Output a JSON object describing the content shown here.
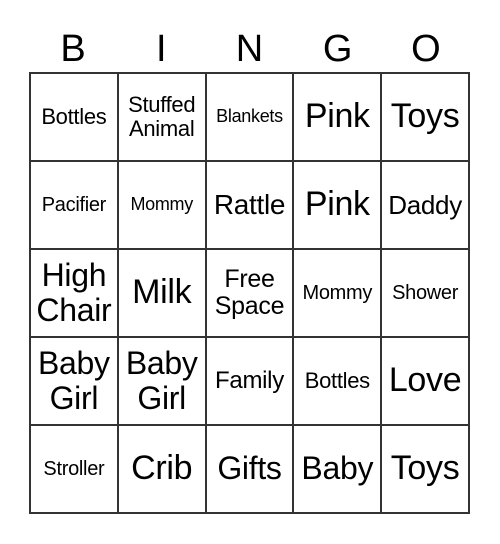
{
  "header": [
    "B",
    "I",
    "N",
    "G",
    "O"
  ],
  "cells": [
    [
      "Bottles",
      "Stuffed Animal",
      "Blankets",
      "Pink",
      "Toys"
    ],
    [
      "Pacifier",
      "Mommy",
      "Rattle",
      "Pink",
      "Daddy"
    ],
    [
      "High Chair",
      "Milk",
      "Free Space",
      "Mommy",
      "Shower"
    ],
    [
      "Baby Girl",
      "Baby Girl",
      "Family",
      "Bottles",
      "Love"
    ],
    [
      "Stroller",
      "Crib",
      "Gifts",
      "Baby",
      "Toys"
    ]
  ]
}
